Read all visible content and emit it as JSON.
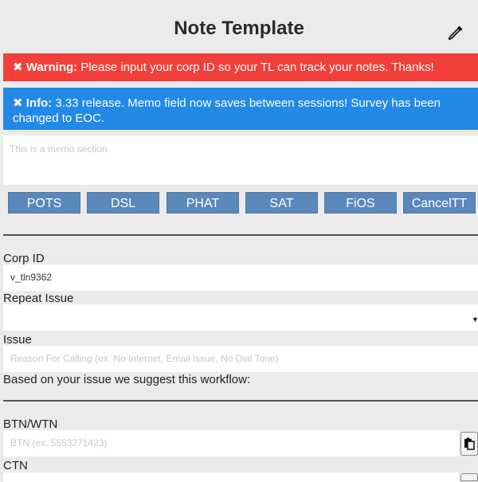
{
  "header": {
    "title": "Note Template",
    "picker_icon": "eyedropper-icon"
  },
  "alerts": {
    "warning": {
      "lead": "✖ Warning:",
      "text": " Please input your corp ID so your TL can track your notes. Thanks!",
      "color": "#f33f3a"
    },
    "info": {
      "lead": "✖ Info:",
      "text": " 3.33 release. Memo field now saves between sessions! Survey has been changed to EOC.",
      "color": "#2289e6"
    }
  },
  "memo": {
    "placeholder": "This is a memo section"
  },
  "buttons": [
    "POTS",
    "DSL",
    "PHAT",
    "SAT",
    "FiOS",
    "CancelTT"
  ],
  "button_color": "#5b88bb",
  "form": {
    "corp_id": {
      "label": "Corp ID",
      "value": "v_tln9362"
    },
    "repeat_issue": {
      "label": "Repeat Issue",
      "value": ""
    },
    "issue": {
      "label": "Issue",
      "placeholder": "Reason For Calling (ex. No Internet, Email Issue, No Dial Tone)"
    },
    "workflow_text": "Based on your issue we suggest this workflow:",
    "btn_wtn": {
      "label": "BTN/WTN",
      "placeholder": "BTN (ex. 5553271423)",
      "copy_icon": "clipboard-icon"
    },
    "ctn": {
      "label": "CTN"
    }
  }
}
